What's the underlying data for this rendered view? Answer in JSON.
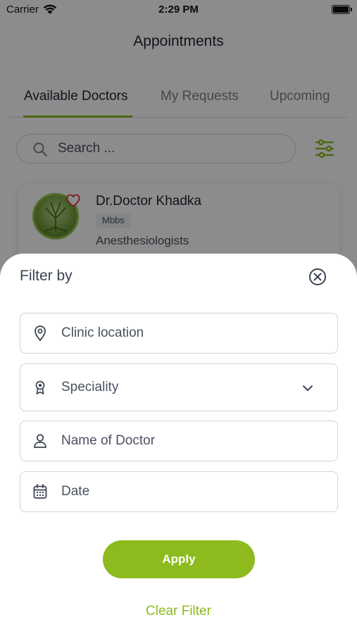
{
  "status_bar": {
    "carrier": "Carrier",
    "time": "2:29 PM"
  },
  "header": {
    "title": "Appointments"
  },
  "tabs": [
    {
      "label": "Available Doctors",
      "active": true
    },
    {
      "label": "My Requests",
      "active": false
    },
    {
      "label": "Upcoming",
      "active": false
    }
  ],
  "search": {
    "placeholder": "Search ..."
  },
  "doctor_card": {
    "name": "Dr.Doctor Khadka",
    "degree": "Mbbs",
    "speciality": "Anesthesiologists"
  },
  "filter_sheet": {
    "title": "Filter by",
    "fields": [
      {
        "label": "Clinic location",
        "icon": "location-pin-icon"
      },
      {
        "label": "Speciality",
        "icon": "award-badge-icon"
      },
      {
        "label": "Name of Doctor",
        "icon": "user-icon"
      },
      {
        "label": "Date",
        "icon": "calendar-icon"
      }
    ],
    "apply_label": "Apply",
    "clear_label": "Clear Filter"
  },
  "colors": {
    "accent": "#8dbb1e",
    "text": "#1d2433",
    "muted": "#4a5160"
  }
}
